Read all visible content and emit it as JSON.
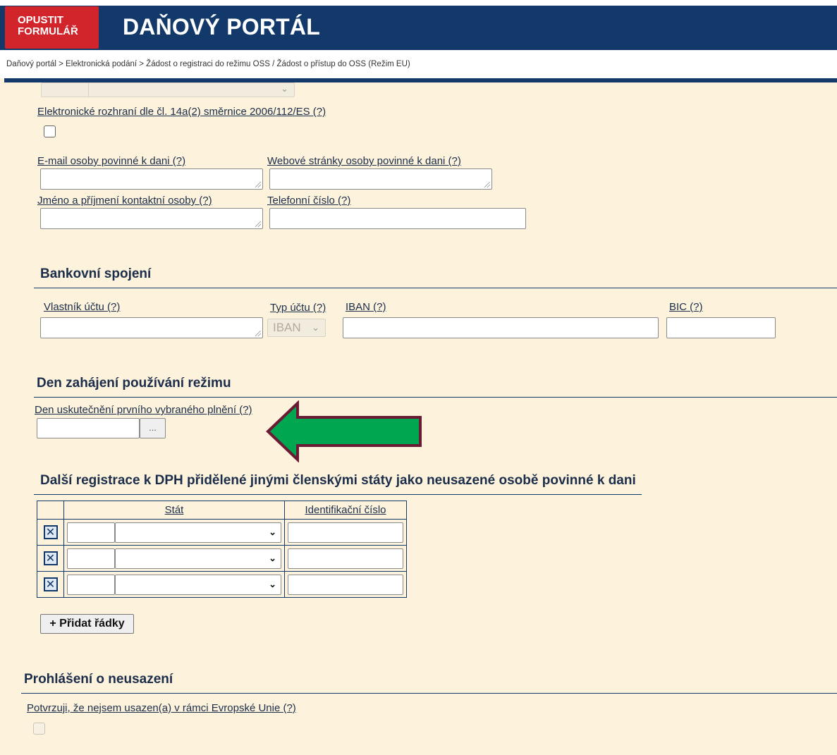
{
  "header": {
    "exit_line1": "OPUSTIT",
    "exit_line2": "FORMULÁŘ",
    "title": "DAŇOVÝ PORTÁL"
  },
  "breadcrumb": "Daňový portál > Elektronická podání > Žádost o registraci do režimu OSS / Žádost o přístup do OSS (Režim EU)",
  "fields": {
    "electronic_interface": "Elektronické rozhraní dle čl. 14a(2) směrnice 2006/112/ES (?)",
    "email": "E-mail osoby povinné k dani (?)",
    "website": "Webové stránky osoby povinné k dani (?)",
    "contact_name": "Jméno a příjmení kontaktní osoby (?)",
    "phone": "Telefonní číslo (?)"
  },
  "bank": {
    "title": "Bankovní spojení",
    "owner": "Vlastník účtu  (?)",
    "account_type": "Typ účtu  (?)",
    "iban": "IBAN  (?)",
    "bic": "BIC  (?)",
    "account_type_value": "IBAN"
  },
  "start": {
    "title": "Den zahájení používání režimu",
    "first_supply": "Den uskutečnění prvního vybraného plnění (?)",
    "date_button": "..."
  },
  "other_reg": {
    "title": "Další registrace k DPH přidělené jinými členskými státy jako neusazené osobě povinné k dani",
    "col_state": "Stát",
    "col_id": "Identifikační číslo",
    "row_count": 3,
    "delete_symbol": "✕",
    "add_rows": "+ Přidat řádky"
  },
  "declaration": {
    "title": "Prohlášení o neusazení",
    "confirm": "Potvrzuji, že nejsem usazen(a) v rámci Evropské Unie (?)"
  },
  "colors": {
    "brand_blue": "#13396b",
    "exit_red": "#d1252b",
    "background": "#fdf3dc",
    "arrow_green": "#00a650",
    "arrow_border": "#6b1a33"
  }
}
